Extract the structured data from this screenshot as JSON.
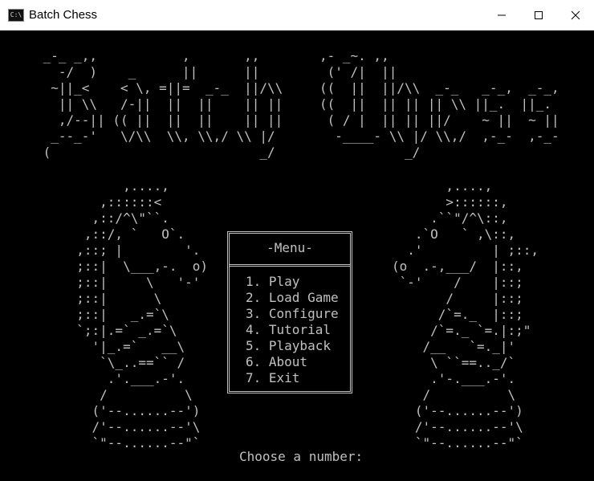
{
  "window": {
    "title": "Batch Chess",
    "icon_text": "C:\\",
    "icons": [
      "console-icon",
      "minimize-icon",
      "maximize-icon",
      "close-icon"
    ]
  },
  "title_art": {
    "batch": " _-_ _,,           ,       ,,\n   -/  )    _      ||      ||\n  ~||_<    < \\, =||=  _-_  ||/\\\\\n   || \\\\   /-||  ||  ||    || ||\n   ,/--|| (( ||  ||  ||    || ||\n  _--_-'   \\/\\\\  \\\\, \\\\,/ \\\\ |/\n (                           _/",
    "chess": ",- _~. ,,\n (' /|  ||\n((  ||  ||/\\\\  _-_   _-_,  _-_,\n((  ||  || || || \\\\ ||_.  ||_.\n ( / |  || || ||/    ~ ||  ~ ||\n  -____- \\\\ |/ \\\\,/  ,-_-  ,-_-\n           _/"
  },
  "knight_left": "        ,....,\n     ,::::::<\n    ,::/^\\\"``.\n   ,::/, `   O`.\n  ,::; |        '.\n  ;::|  \\___,-.  o)\n  ;::|     \\   '-'\n  ;::|      \\\n  ;::|   _.=`\\\n  `;:|.=` _.=`\\\n    '|_.=`   __\\\n     `\\_..==`` /\n      .'.___.-'.\n     /          \\\n    ('--......--')\n    /'--......--'\\\n    `\"--......--\"`",
  "knight_right": "       ,....,\n       >::::::,\n     .``\"/^\\::,\n   .`O   ` ,\\::,\n  .'         | ;::,\n(o  .-,___/  |::,\n `-'    /    |::;\n       /     |::;\n      /`=._  |::;\n     /`=._ `=.|:;\"\n    /__   `=._|'\n     \\ ``==.._/`\n     .'-.___.-'.\n    /          \\\n   ('--......--')\n   /'--......--'\\\n   `\"--......--\"`",
  "menu": {
    "header": "-Menu-",
    "items": [
      {
        "label": "1. Play"
      },
      {
        "label": "2. Load Game"
      },
      {
        "label": "3. Configure"
      },
      {
        "label": "4. Tutorial"
      },
      {
        "label": "5. Playback"
      },
      {
        "label": "6. About"
      },
      {
        "label": "7. Exit"
      }
    ]
  },
  "prompt": "Choose a number:"
}
